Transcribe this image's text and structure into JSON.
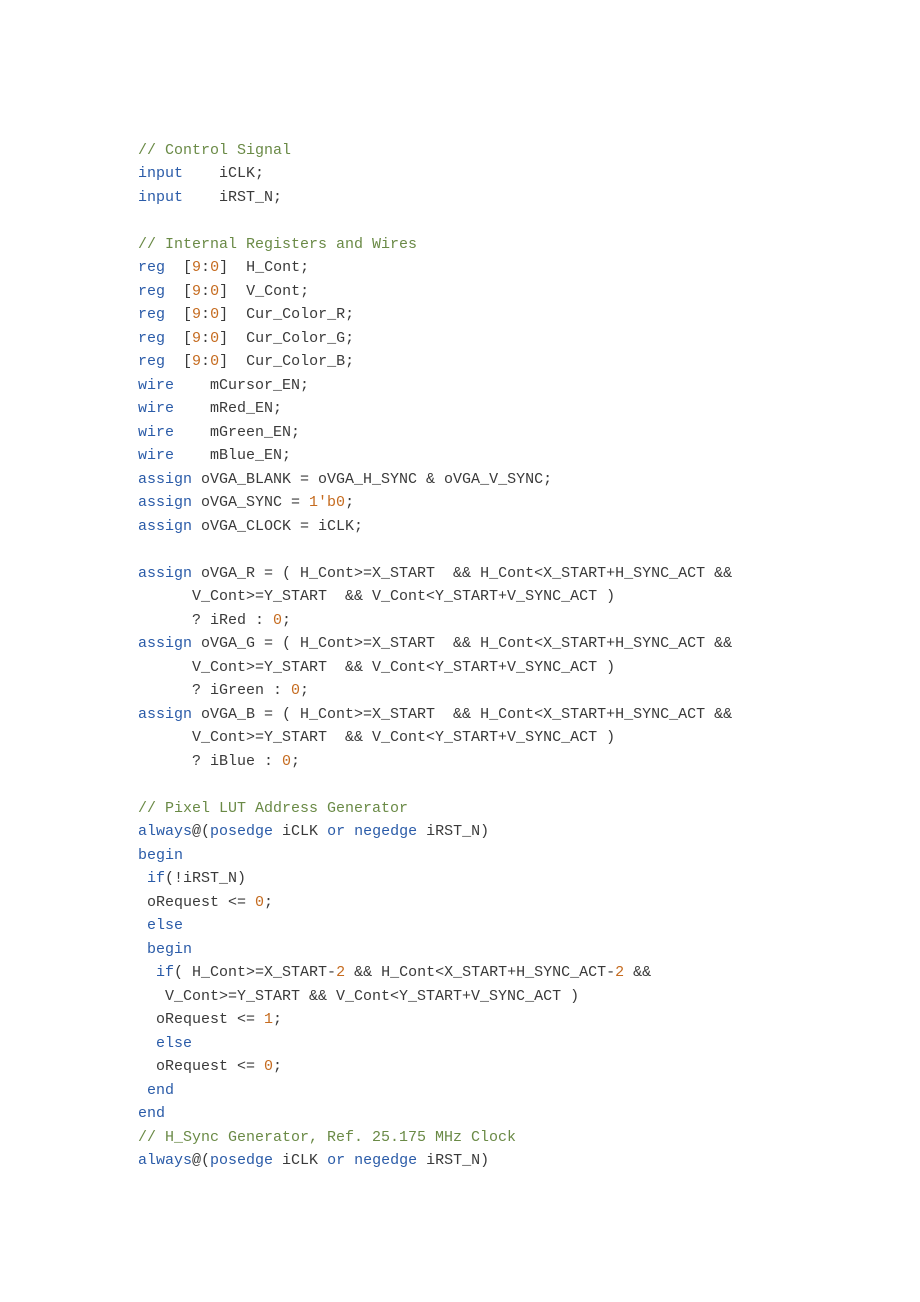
{
  "code": {
    "l01": "// Control Signal",
    "l02_a": "input",
    "l02_b": "    iCLK;",
    "l03_a": "input",
    "l03_b": "    iRST_N;",
    "l04": "",
    "l05": "// Internal Registers and Wires",
    "l06_a": "reg",
    "l06_b": "  [",
    "l06_c": "9",
    "l06_d": ":",
    "l06_e": "0",
    "l06_f": "]  H_Cont;",
    "l07_a": "reg",
    "l07_b": "  [",
    "l07_c": "9",
    "l07_d": ":",
    "l07_e": "0",
    "l07_f": "]  V_Cont;",
    "l08_a": "reg",
    "l08_b": "  [",
    "l08_c": "9",
    "l08_d": ":",
    "l08_e": "0",
    "l08_f": "]  Cur_Color_R;",
    "l09_a": "reg",
    "l09_b": "  [",
    "l09_c": "9",
    "l09_d": ":",
    "l09_e": "0",
    "l09_f": "]  Cur_Color_G;",
    "l10_a": "reg",
    "l10_b": "  [",
    "l10_c": "9",
    "l10_d": ":",
    "l10_e": "0",
    "l10_f": "]  Cur_Color_B;",
    "l11_a": "wire",
    "l11_b": "    mCursor_EN;",
    "l12_a": "wire",
    "l12_b": "    mRed_EN;",
    "l13_a": "wire",
    "l13_b": "    mGreen_EN;",
    "l14_a": "wire",
    "l14_b": "    mBlue_EN;",
    "l15_a": "assign",
    "l15_b": " oVGA_BLANK = oVGA_H_SYNC & oVGA_V_SYNC;",
    "l16_a": "assign",
    "l16_b": " oVGA_SYNC = ",
    "l16_c": "1'b0",
    "l16_d": ";",
    "l17_a": "assign",
    "l17_b": " oVGA_CLOCK = iCLK;",
    "l18": "",
    "l19_a": "assign",
    "l19_b": " oVGA_R = ( H_Cont>=X_START  && H_Cont<X_START+H_SYNC_ACT &&",
    "l20": "      V_Cont>=Y_START  && V_Cont<Y_START+V_SYNC_ACT )",
    "l21_a": "      ? iRed : ",
    "l21_b": "0",
    "l21_c": ";",
    "l22_a": "assign",
    "l22_b": " oVGA_G = ( H_Cont>=X_START  && H_Cont<X_START+H_SYNC_ACT &&",
    "l23": "      V_Cont>=Y_START  && V_Cont<Y_START+V_SYNC_ACT )",
    "l24_a": "      ? iGreen : ",
    "l24_b": "0",
    "l24_c": ";",
    "l25_a": "assign",
    "l25_b": " oVGA_B = ( H_Cont>=X_START  && H_Cont<X_START+H_SYNC_ACT &&",
    "l26": "      V_Cont>=Y_START  && V_Cont<Y_START+V_SYNC_ACT )",
    "l27_a": "      ? iBlue : ",
    "l27_b": "0",
    "l27_c": ";",
    "l28": "",
    "l29": "// Pixel LUT Address Generator",
    "l30_a": "always",
    "l30_b": "@(",
    "l30_c": "posedge",
    "l30_d": " iCLK ",
    "l30_e": "or",
    "l30_f": " ",
    "l30_g": "negedge",
    "l30_h": " iRST_N)",
    "l31": "begin",
    "l32_a": " ",
    "l32_b": "if",
    "l32_c": "(!iRST_N)",
    "l33_a": " oRequest <= ",
    "l33_b": "0",
    "l33_c": ";",
    "l34_a": " ",
    "l34_b": "else",
    "l35_a": " ",
    "l35_b": "begin",
    "l36_a": "  ",
    "l36_b": "if",
    "l36_c": "( H_Cont>=X_START-",
    "l36_d": "2",
    "l36_e": " && H_Cont<X_START+H_SYNC_ACT-",
    "l36_f": "2",
    "l36_g": " &&",
    "l37": "   V_Cont>=Y_START && V_Cont<Y_START+V_SYNC_ACT )",
    "l38_a": "  oRequest <= ",
    "l38_b": "1",
    "l38_c": ";",
    "l39_a": "  ",
    "l39_b": "else",
    "l40_a": "  oRequest <= ",
    "l40_b": "0",
    "l40_c": ";",
    "l41_a": " ",
    "l41_b": "end",
    "l42": "end",
    "l43": "// H_Sync Generator, Ref. 25.175 MHz Clock",
    "l44_a": "always",
    "l44_b": "@(",
    "l44_c": "posedge",
    "l44_d": " iCLK ",
    "l44_e": "or",
    "l44_f": " ",
    "l44_g": "negedge",
    "l44_h": " iRST_N)"
  }
}
